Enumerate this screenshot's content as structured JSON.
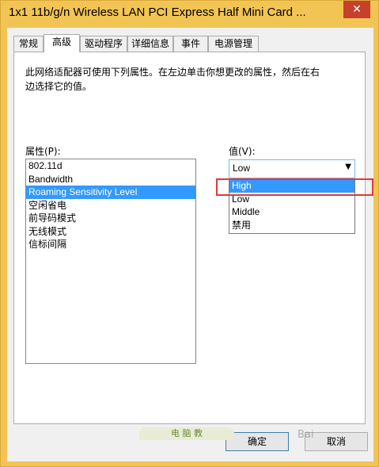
{
  "window": {
    "title": "1x1 11b/g/n Wireless LAN PCI Express Half Mini Card ...",
    "close_label": "✕"
  },
  "tabs": [
    {
      "label": "常规"
    },
    {
      "label": "高级"
    },
    {
      "label": "驱动程序"
    },
    {
      "label": "详细信息"
    },
    {
      "label": "事件"
    },
    {
      "label": "电源管理"
    }
  ],
  "panel": {
    "description": "此网络适配器可使用下列属性。在左边单击你想更改的属性，然后在右边选择它的值。",
    "property_label": "属性(P):",
    "value_label": "值(V):",
    "properties": [
      "802.11d",
      "Bandwidth",
      "Roaming Sensitivity Level",
      "空闲省电",
      "前导码模式",
      "无线模式",
      "信标间隔"
    ],
    "selected_property_index": 2,
    "value_selected": "Low",
    "value_options": [
      "High",
      "Low",
      "Middle",
      "禁用"
    ],
    "hover_option_index": 0
  },
  "buttons": {
    "ok": "确定",
    "cancel": "取消"
  },
  "watermark": {
    "text": "Bai",
    "banner": "电 脑 教"
  }
}
